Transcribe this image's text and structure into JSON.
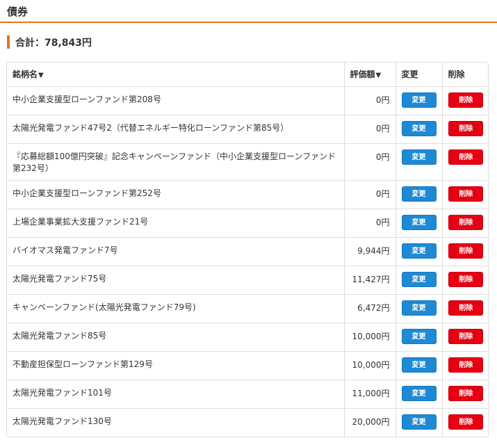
{
  "section": {
    "title": "債券"
  },
  "total": {
    "text": "合計：78,843円"
  },
  "table": {
    "headers": {
      "name": "銘柄名",
      "name_sort": "▼",
      "amount": "評価額",
      "amount_sort": "▼",
      "change": "変更",
      "delete": "削除"
    },
    "change_label": "変更",
    "delete_label": "削除",
    "rows": [
      {
        "name": "中小企業支援型ローンファンド第208号",
        "amount": "0円"
      },
      {
        "name": "太陽光発電ファンド47号2（代替エネルギー特化ローンファンド第85号）",
        "amount": "0円"
      },
      {
        "name": "『応募総額100億円突破』記念キャンペーンファンド（中小企業支援型ローンファンド第232号）",
        "amount": "0円"
      },
      {
        "name": "中小企業支援型ローンファンド第252号",
        "amount": "0円"
      },
      {
        "name": "上場企業事業拡大支援ファンド21号",
        "amount": "0円"
      },
      {
        "name": "バイオマス発電ファンド7号",
        "amount": "9,944円"
      },
      {
        "name": "太陽光発電ファンド75号",
        "amount": "11,427円"
      },
      {
        "name": "キャンペーンファンド(太陽光発電ファンド79号)",
        "amount": "6,472円"
      },
      {
        "name": "太陽光発電ファンド85号",
        "amount": "10,000円"
      },
      {
        "name": "不動産担保型ローンファンド第129号",
        "amount": "10,000円"
      },
      {
        "name": "太陽光発電ファンド101号",
        "amount": "11,000円"
      },
      {
        "name": "太陽光発電ファンド130号",
        "amount": "20,000円"
      }
    ]
  },
  "colors": {
    "accent": "#e8731e",
    "change_button": "#1e8ad6",
    "delete_button": "#e60012"
  }
}
